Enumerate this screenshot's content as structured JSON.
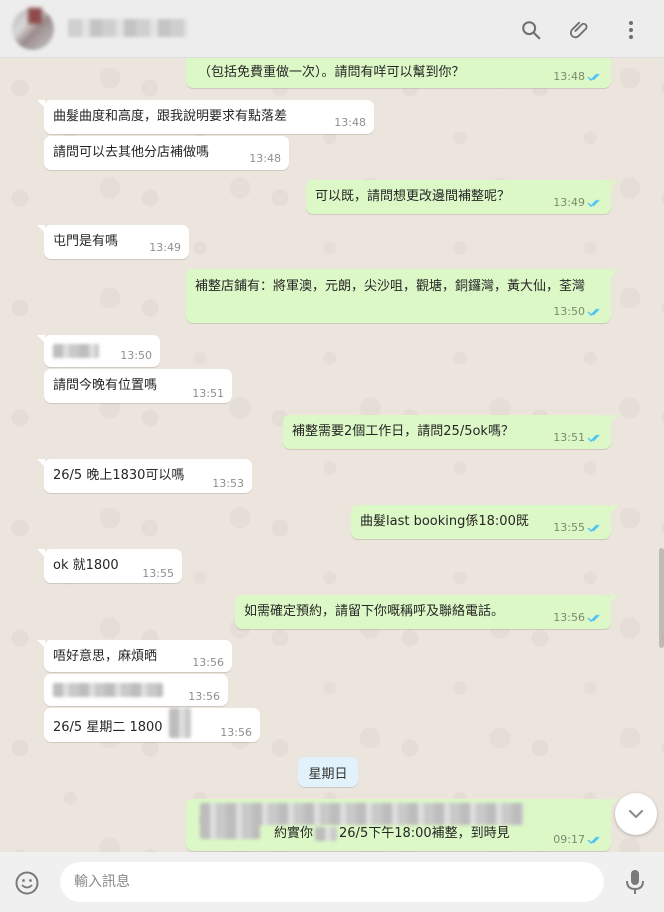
{
  "header": {
    "icons": [
      "search-icon",
      "attach-icon",
      "menu-icon"
    ]
  },
  "messages": [
    {
      "dir": "out",
      "text": "（包括免費重做一次）。請問有咩可以幫到你？",
      "time": "13:48"
    },
    {
      "dir": "in",
      "text": "曲髮曲度和高度，跟我說明要求有點落差",
      "time": "13:48"
    },
    {
      "dir": "in",
      "text": "請問可以去其他分店補做嗎",
      "time": "13:48"
    },
    {
      "dir": "out",
      "text": "可以既，請問想更改邊間補整呢？",
      "time": "13:49"
    },
    {
      "dir": "in",
      "text": "屯門是有嗎",
      "time": "13:49"
    },
    {
      "dir": "out",
      "text": "補整店鋪有：將軍澳，元朗，尖沙咀，觀塘，銅鑼灣，黃大仙，荃灣",
      "time": "13:50"
    },
    {
      "dir": "in",
      "text": "",
      "time": "13:50"
    },
    {
      "dir": "in",
      "text": "請問今晚有位置嗎",
      "time": "13:51"
    },
    {
      "dir": "out",
      "text": "補整需要2個工作日，請問25/5ok嗎？",
      "time": "13:51"
    },
    {
      "dir": "in",
      "text": "26/5 晚上1830可以嗎",
      "time": "13:53"
    },
    {
      "dir": "out",
      "text": "曲髮last booking係18:00既",
      "time": "13:55"
    },
    {
      "dir": "in",
      "text": "ok 就1800",
      "time": "13:55"
    },
    {
      "dir": "out",
      "text": "如需確定預約，請留下你嘅稱呼及聯絡電話。",
      "time": "13:56"
    },
    {
      "dir": "in",
      "text": "唔好意思，麻煩晒",
      "time": "13:56"
    },
    {
      "dir": "in",
      "text": "",
      "time": "13:56"
    },
    {
      "dir": "in",
      "text": "26/5 星期二 1800",
      "time": "13:56"
    },
    {
      "dir": "out",
      "text_before": "約實你",
      "text_after": "26/5下午18:00補整，到時見",
      "time": "09:17"
    }
  ],
  "day_separator": "星期日",
  "composer": {
    "placeholder": "輸入訊息"
  }
}
